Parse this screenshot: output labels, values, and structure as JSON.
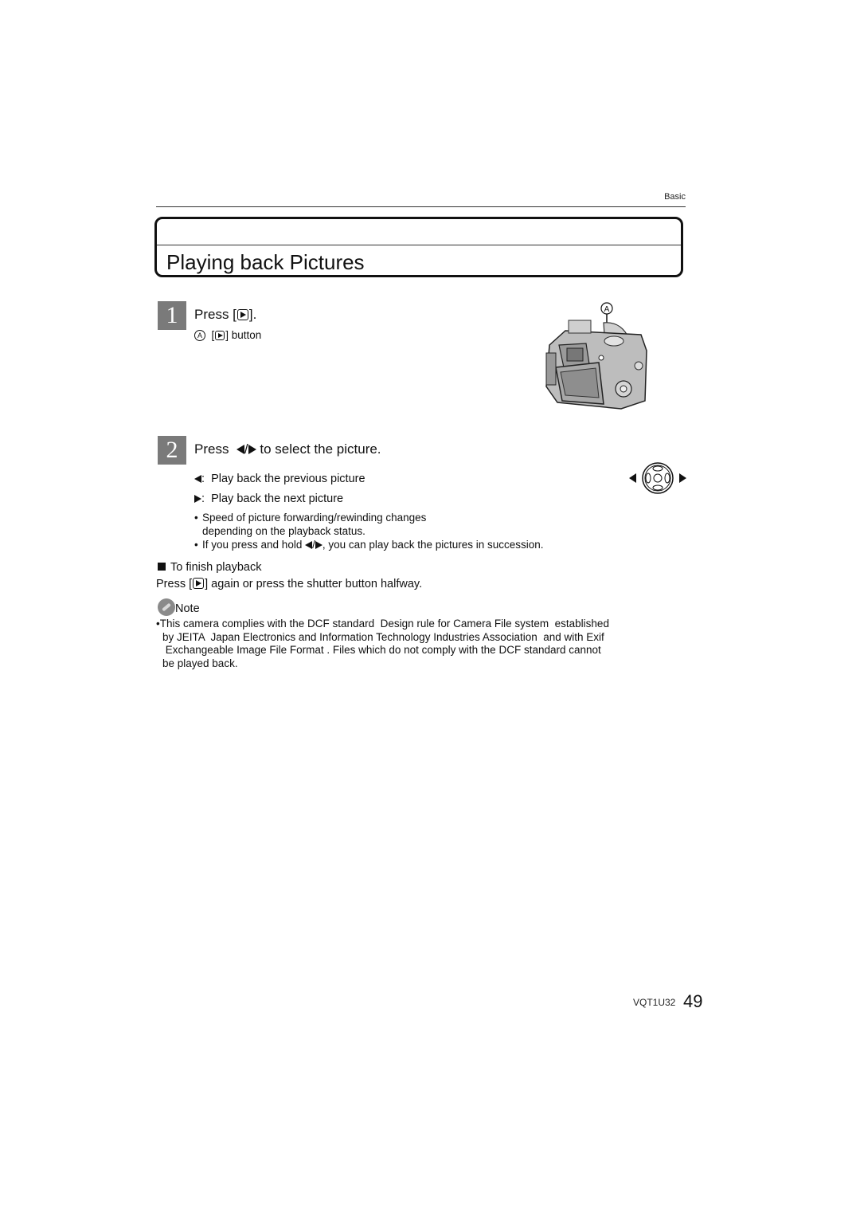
{
  "header": {
    "section_label": "Basic"
  },
  "title": "Playing back Pictures",
  "step1": {
    "number": "1",
    "title_prefix": "Press [",
    "title_suffix": "].",
    "callout_letter": "A",
    "callout_text_prefix": "[",
    "callout_text_suffix": "] button",
    "figure_label": "A",
    "figure_alt": "camera-rear-view-illustration"
  },
  "step2": {
    "number": "2",
    "title_prefix": "Press",
    "title_suffix": "to select the picture.",
    "items": [
      {
        "key": "left-arrow",
        "text": ":  Play back the previous picture"
      },
      {
        "key": "right-arrow",
        "text": ":  Play back the next picture"
      }
    ],
    "bullets": [
      {
        "text_line1": "Speed of picture forwarding/rewinding changes",
        "text_line2": "depending on the playback status."
      },
      {
        "text_prefix": "If you press and hold",
        "text_suffix": ", you can play back the pictures in succession."
      }
    ]
  },
  "finish": {
    "heading": "To finish playback",
    "text_prefix": "Press [",
    "text_suffix": "] again or press the shutter button halfway."
  },
  "note": {
    "label": "Note",
    "lines": [
      "This camera complies with the DCF standard  Design rule for Camera File system  established",
      "by JEITA  Japan Electronics and Information Technology Industries Association  and with Exif",
      " Exchangeable Image File Format . Files which do not comply with the DCF standard cannot",
      "be played back."
    ]
  },
  "footer": {
    "doc_code": "VQT1U32",
    "page_number": "49"
  }
}
